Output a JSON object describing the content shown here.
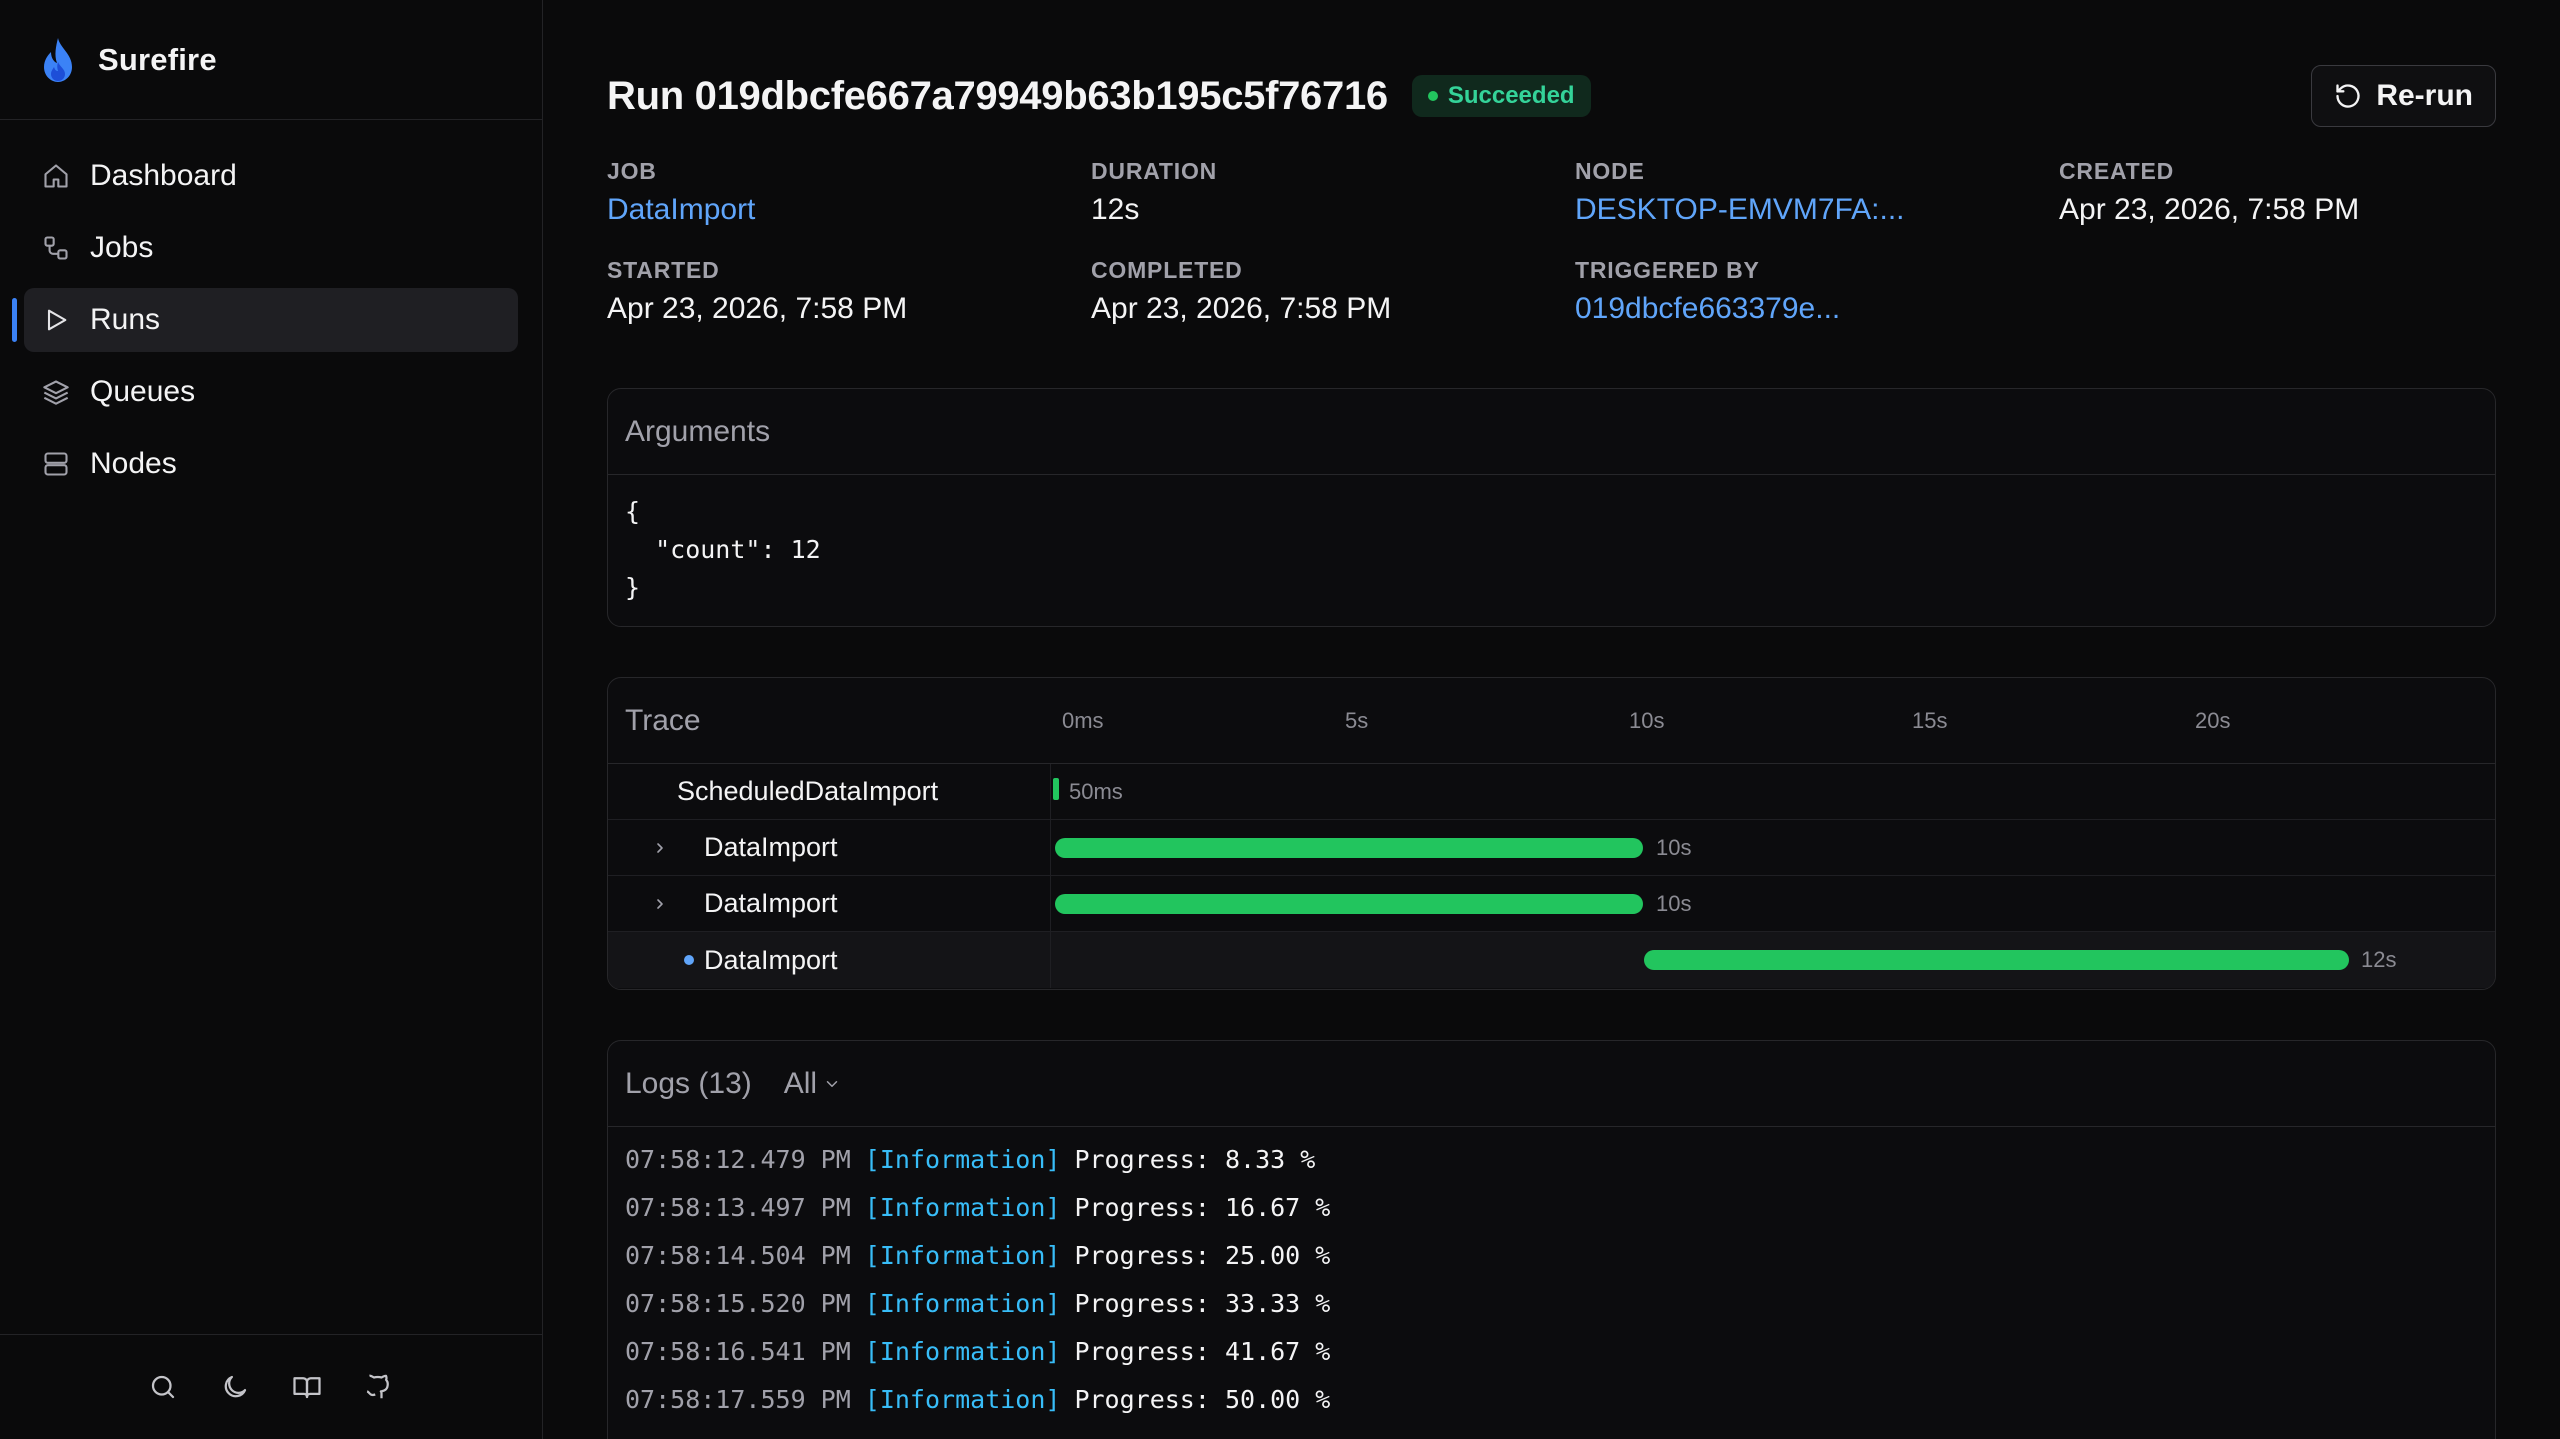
{
  "brand": {
    "name": "Surefire"
  },
  "nav": {
    "items": [
      {
        "label": "Dashboard",
        "icon": "home-icon"
      },
      {
        "label": "Jobs",
        "icon": "jobs-icon"
      },
      {
        "label": "Runs",
        "icon": "play-icon",
        "active": true
      },
      {
        "label": "Queues",
        "icon": "layers-icon"
      },
      {
        "label": "Nodes",
        "icon": "server-icon"
      }
    ]
  },
  "footer": {
    "icons": [
      "search-icon",
      "moon-icon",
      "book-icon",
      "github-icon"
    ]
  },
  "header": {
    "title": "Run 019dbcfe667a79949b63b195c5f76716",
    "status": "Succeeded",
    "rerun_label": "Re-run"
  },
  "meta": {
    "job_label": "JOB",
    "job_value": "DataImport",
    "duration_label": "DURATION",
    "duration_value": "12s",
    "node_label": "NODE",
    "node_value": "DESKTOP-EMVM7FA:...",
    "created_label": "CREATED",
    "created_value": "Apr 23, 2026, 7:58 PM",
    "started_label": "STARTED",
    "started_value": "Apr 23, 2026, 7:58 PM",
    "completed_label": "COMPLETED",
    "completed_value": "Apr 23, 2026, 7:58 PM",
    "triggered_label": "TRIGGERED BY",
    "triggered_value": "019dbcfe663379e..."
  },
  "arguments": {
    "title": "Arguments",
    "json": "{\n  \"count\": 12\n}"
  },
  "trace": {
    "title": "Trace",
    "ticks": [
      "0ms",
      "5s",
      "10s",
      "15s",
      "20s"
    ],
    "rows": [
      {
        "name": "ScheduledDataImport",
        "duration": "50ms",
        "expandable": false,
        "current": false
      },
      {
        "name": "DataImport",
        "duration": "10s",
        "expandable": true,
        "current": false
      },
      {
        "name": "DataImport",
        "duration": "10s",
        "expandable": true,
        "current": false
      },
      {
        "name": "DataImport",
        "duration": "12s",
        "expandable": false,
        "current": true
      }
    ]
  },
  "logs": {
    "title": "Logs (13)",
    "filter": "All",
    "lines": [
      {
        "time": "07:58:12.479 PM",
        "level": "[Information]",
        "message": "Progress: 8.33 %"
      },
      {
        "time": "07:58:13.497 PM",
        "level": "[Information]",
        "message": "Progress: 16.67 %"
      },
      {
        "time": "07:58:14.504 PM",
        "level": "[Information]",
        "message": "Progress: 25.00 %"
      },
      {
        "time": "07:58:15.520 PM",
        "level": "[Information]",
        "message": "Progress: 33.33 %"
      },
      {
        "time": "07:58:16.541 PM",
        "level": "[Information]",
        "message": "Progress: 41.67 %"
      },
      {
        "time": "07:58:17.559 PM",
        "level": "[Information]",
        "message": "Progress: 50.00 %"
      }
    ]
  },
  "colors": {
    "accent": "#3b82f6",
    "success": "#22c55e",
    "link": "#60a5fa",
    "log_level": "#38bdf8"
  }
}
